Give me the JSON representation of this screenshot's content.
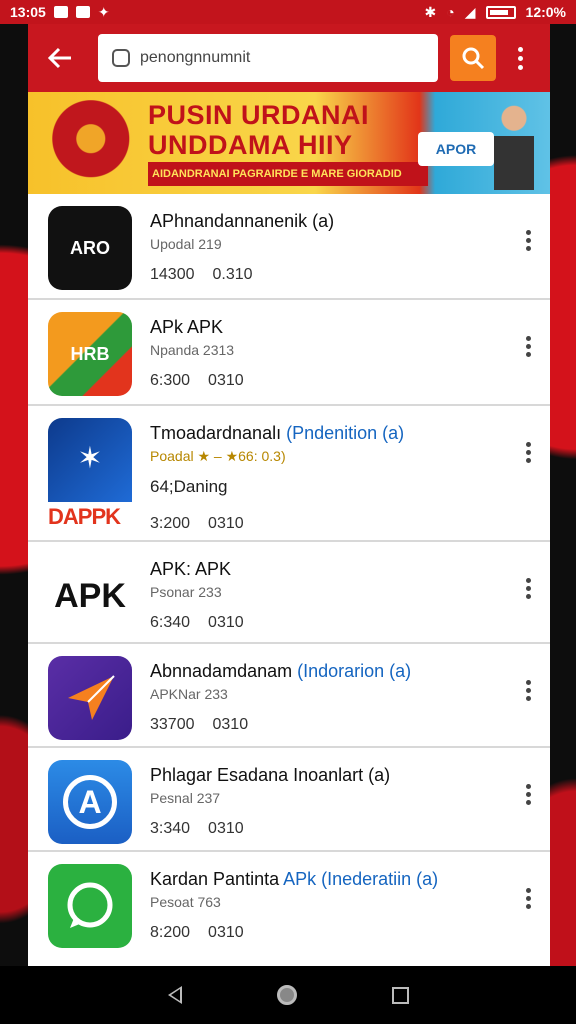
{
  "status_bar": {
    "time_left": "13:05",
    "time_right": "12:0%"
  },
  "toolbar": {
    "search_value": "penongnnumnit",
    "colors": {
      "toolbar": "#c8171f",
      "search_button": "#f5801f"
    }
  },
  "banner": {
    "title_line1": "PUSIN URDANAI",
    "title_line2": "UNDDAMA HIIY",
    "subtitle": "AIDANDRANAI PAGRAIRDE E MARE GIORADID",
    "badge": "APOR"
  },
  "apps": [
    {
      "name": "APhnandannanenik (a)",
      "highlight": "",
      "developer": "Upodal 219",
      "extra": "",
      "size": "14300",
      "count": "0.310",
      "icon_label": "ARO",
      "icon": "aro-app-icon"
    },
    {
      "name": "APk APK",
      "highlight": "",
      "developer": "Npanda 2313",
      "extra": "",
      "size": "6:300",
      "count": "0310",
      "icon_label": "HRB",
      "icon": "apk-star-app-icon"
    },
    {
      "name": "Tmoadardnanalı ",
      "highlight": "(Pndenition (a)",
      "developer": "Poadal ★ – ★66: 0.3)",
      "extra": "64;Daning",
      "size": "3:200",
      "count": "0310",
      "icon_label": "DAPPK",
      "icon": "dappk-app-icon"
    },
    {
      "name": "APK: APK",
      "highlight": "",
      "developer": "Psonar 233",
      "extra": "",
      "size": "6:340",
      "count": "0310",
      "icon_label": "APK",
      "icon": "apk-text-app-icon"
    },
    {
      "name": "Abnnadamdanam ",
      "highlight": "(Indorarion (a)",
      "developer": "APKNar 233",
      "extra": "",
      "size": "33700",
      "count": "0310",
      "icon_label": "",
      "icon": "paper-plane-app-icon"
    },
    {
      "name": "Phlagar Esadana Inoanlart (a)",
      "highlight": "",
      "developer": "Pesnal 237",
      "extra": "",
      "size": "3:340",
      "count": "0310",
      "icon_label": "A",
      "icon": "letter-a-app-icon"
    },
    {
      "name": "Kardan Pantinta ",
      "highlight": "APk (Inederatiin (a)",
      "developer": "Pesoat 763",
      "extra": "",
      "size": "8:200",
      "count": "0310",
      "icon_label": "",
      "icon": "chat-bubble-app-icon"
    }
  ]
}
